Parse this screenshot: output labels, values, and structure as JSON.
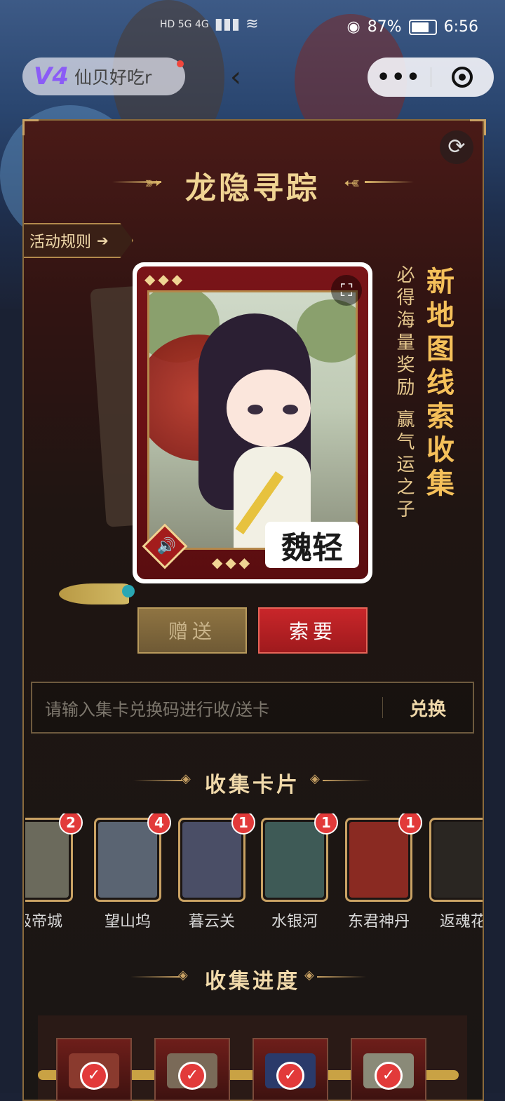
{
  "status_bar": {
    "network": "HD 5G 4G",
    "battery": "87%",
    "battery_level": 0.87,
    "time": "6:56"
  },
  "mini_program": {
    "logo_text": "V4",
    "name": "仙贝好吃r"
  },
  "page": {
    "title": "龙隐寻踪",
    "rules_label": "活动规则",
    "card_name": "魏轻",
    "vertical_main": "新地图线索收集",
    "vertical_sub": "必得海量奖励 赢气运之子",
    "gift_label": "赠送",
    "ask_label": "索要",
    "redeem_placeholder": "请输入集卡兑换码进行收/送卡",
    "redeem_button": "兑换",
    "collect_cards_title": "收集卡片",
    "progress_title": "收集进度"
  },
  "collect_cards": [
    {
      "label": "极帝城",
      "count": "2",
      "color": "#6b6a5c"
    },
    {
      "label": "望山坞",
      "count": "4",
      "color": "#5a6472"
    },
    {
      "label": "暮云关",
      "count": "1",
      "color": "#4a4e66"
    },
    {
      "label": "水银河",
      "count": "1",
      "color": "#3e5a56"
    },
    {
      "label": "东君神丹",
      "count": "1",
      "color": "#8a2a22"
    },
    {
      "label": "返魂花",
      "count": "",
      "color": "#2a2622"
    }
  ],
  "progress_chests": [
    {
      "state": "collected",
      "color": "#8a3a2e"
    },
    {
      "state": "collected",
      "color": "#7a6a58"
    },
    {
      "state": "collected",
      "color": "#2a3a6a"
    },
    {
      "state": "collected",
      "color": "#8a8a78"
    }
  ],
  "colors": {
    "gold": "#f0d493",
    "accent_red": "#c9262a",
    "badge_red": "#e23a3a"
  },
  "icons": {
    "back": "chevron-left-icon",
    "more": "more-dots-icon",
    "close": "target-close-icon",
    "refresh": "refresh-icon",
    "fullscreen": "fullscreen-icon",
    "sound": "speaker-icon",
    "check": "check-icon"
  }
}
